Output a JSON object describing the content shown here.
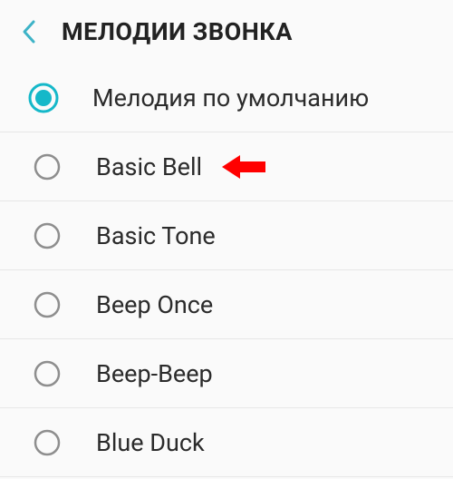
{
  "header": {
    "title": "МЕЛОДИИ ЗВОНКА"
  },
  "accent_color": "#15b8c9",
  "annotation_color": "#ff0000",
  "selected_index": 0,
  "annotated_index": 1,
  "ringtones": [
    {
      "label": "Мелодия по умолчанию"
    },
    {
      "label": "Basic Bell"
    },
    {
      "label": "Basic Tone"
    },
    {
      "label": "Beep Once"
    },
    {
      "label": "Beep-Beep"
    },
    {
      "label": "Blue Duck"
    }
  ]
}
